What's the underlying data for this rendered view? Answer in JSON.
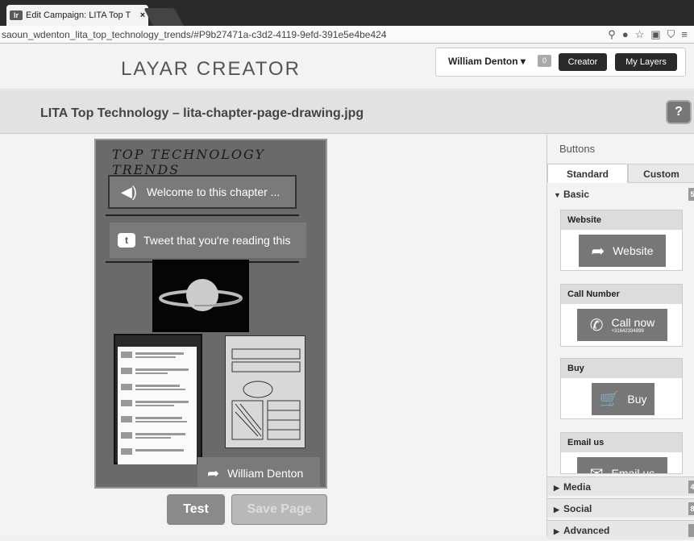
{
  "browser": {
    "tab_title": "Edit Campaign: LITA Top T",
    "favicon": "lr",
    "close": "×",
    "url": "saoun_wdenton_lita_top_technology_trends/#P9b27471a-c3d2-4119-9efd-391e5e4be424",
    "icons": [
      "share-icon",
      "abp-icon",
      "star-icon",
      "cast-icon",
      "shield-icon",
      "menu-icon"
    ]
  },
  "header": {
    "logo": "LAYAR CREATOR",
    "user": "William Denton",
    "user_menu_glyph": "▾",
    "notification_count": "0",
    "creator_button": "Creator",
    "my_layers_button": "My Layers"
  },
  "subheader": {
    "title": "LITA Top Technology  –  lita-chapter-page-drawing.jpg",
    "help": "?"
  },
  "canvas": {
    "drawn_title": "TOP TECHNOLOGY TRENDS",
    "welcome": "Welcome to this chapter ...",
    "tweet": "Tweet that you're reading this",
    "author_button": "William Denton"
  },
  "actions": {
    "test": "Test",
    "save": "Save Page"
  },
  "sidebar": {
    "heading": "Buttons",
    "tabs": [
      {
        "label": "Standard"
      },
      {
        "label": "Custom"
      }
    ],
    "basic": {
      "label": "Basic",
      "count": "5"
    },
    "cards": [
      {
        "title": "Website",
        "button": "Website",
        "icon": "arrow-icon"
      },
      {
        "title": "Call Number",
        "button": "Call now",
        "sub": "+31642334899",
        "icon": "phone-icon"
      },
      {
        "title": "Buy",
        "button": "Buy",
        "icon": "cart-icon"
      },
      {
        "title": "Email us",
        "button": "Email us",
        "icon": "email-icon"
      }
    ],
    "sections": [
      {
        "label": "Media",
        "count": "4"
      },
      {
        "label": "Social",
        "count": "8"
      },
      {
        "label": "Advanced",
        "count": ""
      }
    ]
  }
}
